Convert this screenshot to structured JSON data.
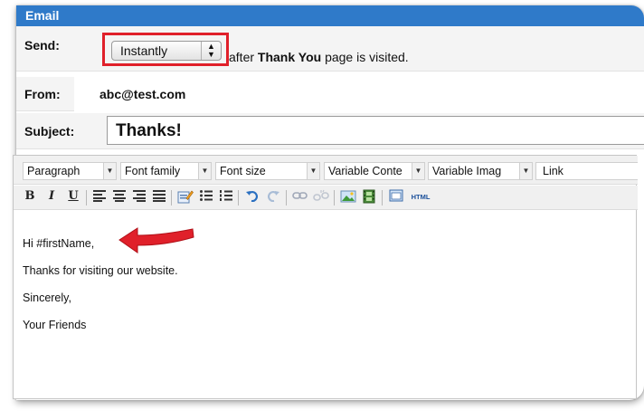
{
  "section_title": "Email",
  "send": {
    "label": "Send:",
    "select_value": "Instantly",
    "text_after": "after",
    "page_name": "Thank You",
    "text_end": "page is visited."
  },
  "from": {
    "label": "From:",
    "value": "abc@test.com"
  },
  "subject": {
    "label": "Subject:",
    "value": "Thanks!"
  },
  "toolbar": {
    "paragraph": "Paragraph",
    "font_family": "Font family",
    "font_size": "Font size",
    "variable_content": "Variable Conte",
    "variable_image": "Variable Imag",
    "link": "Link",
    "bold": "B",
    "italic": "I",
    "underline": "U",
    "html": "HTML"
  },
  "body": {
    "line1": "Hi #firstName,",
    "line2": "Thanks for visiting our website.",
    "line3": "Sincerely,",
    "line4": "Your Friends"
  },
  "colors": {
    "title_bar": "#2f7ac9",
    "highlight": "#e0202a",
    "callout_arrow": "#e0202a"
  }
}
